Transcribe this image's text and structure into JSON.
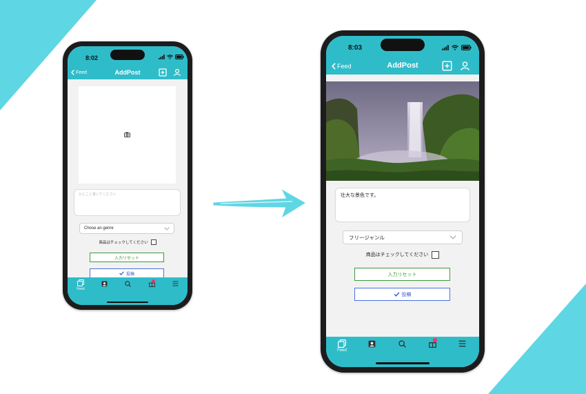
{
  "colors": {
    "accent": "#2fbcc9",
    "decoration": "#5fd6e4",
    "reset_border": "#3c9a3c",
    "post_border": "#4a6fe0",
    "badge": "#ff2d6f"
  },
  "phone_before": {
    "status": {
      "time": "8:02"
    },
    "navbar": {
      "back_label": "Feed",
      "title": "AddPost",
      "back_icon": "chevron-left-icon",
      "add_icon": "plus-square-icon",
      "profile_icon": "person-icon"
    },
    "image_picker": {
      "icon": "camera-icon"
    },
    "caption": {
      "placeholder": "ひとこと書いてください",
      "value": ""
    },
    "genre": {
      "selected": "Chose an genre"
    },
    "product_check": {
      "label": "商品はチェックしてください",
      "checked": false
    },
    "reset_button": {
      "label": "入力リセット"
    },
    "post_button": {
      "label": "投稿",
      "icon": "checkmark-icon"
    },
    "tabbar": {
      "items": [
        {
          "label": "Feed",
          "icon": "feed-icon"
        },
        {
          "label": "",
          "icon": "contacts-icon"
        },
        {
          "label": "",
          "icon": "search-icon"
        },
        {
          "label": "",
          "icon": "gift-icon"
        },
        {
          "label": "",
          "icon": "menu-icon"
        }
      ]
    }
  },
  "phone_after": {
    "status": {
      "time": "8:03"
    },
    "navbar": {
      "back_label": "Feed",
      "title": "AddPost",
      "back_icon": "chevron-left-icon",
      "add_icon": "plus-square-icon",
      "profile_icon": "person-icon"
    },
    "image_picker": {
      "image": "waterfall-photo"
    },
    "caption": {
      "placeholder": "",
      "value": "壮大な景色です。"
    },
    "genre": {
      "selected": "フリージャンル"
    },
    "product_check": {
      "label": "商品はチェックしてください",
      "checked": false
    },
    "reset_button": {
      "label": "入力リセット"
    },
    "post_button": {
      "label": "投稿",
      "icon": "checkmark-icon"
    },
    "tabbar": {
      "items": [
        {
          "label": "Feed",
          "icon": "feed-icon"
        },
        {
          "label": "",
          "icon": "contacts-icon"
        },
        {
          "label": "",
          "icon": "search-icon"
        },
        {
          "label": "",
          "icon": "gift-icon"
        },
        {
          "label": "",
          "icon": "menu-icon"
        }
      ]
    }
  }
}
